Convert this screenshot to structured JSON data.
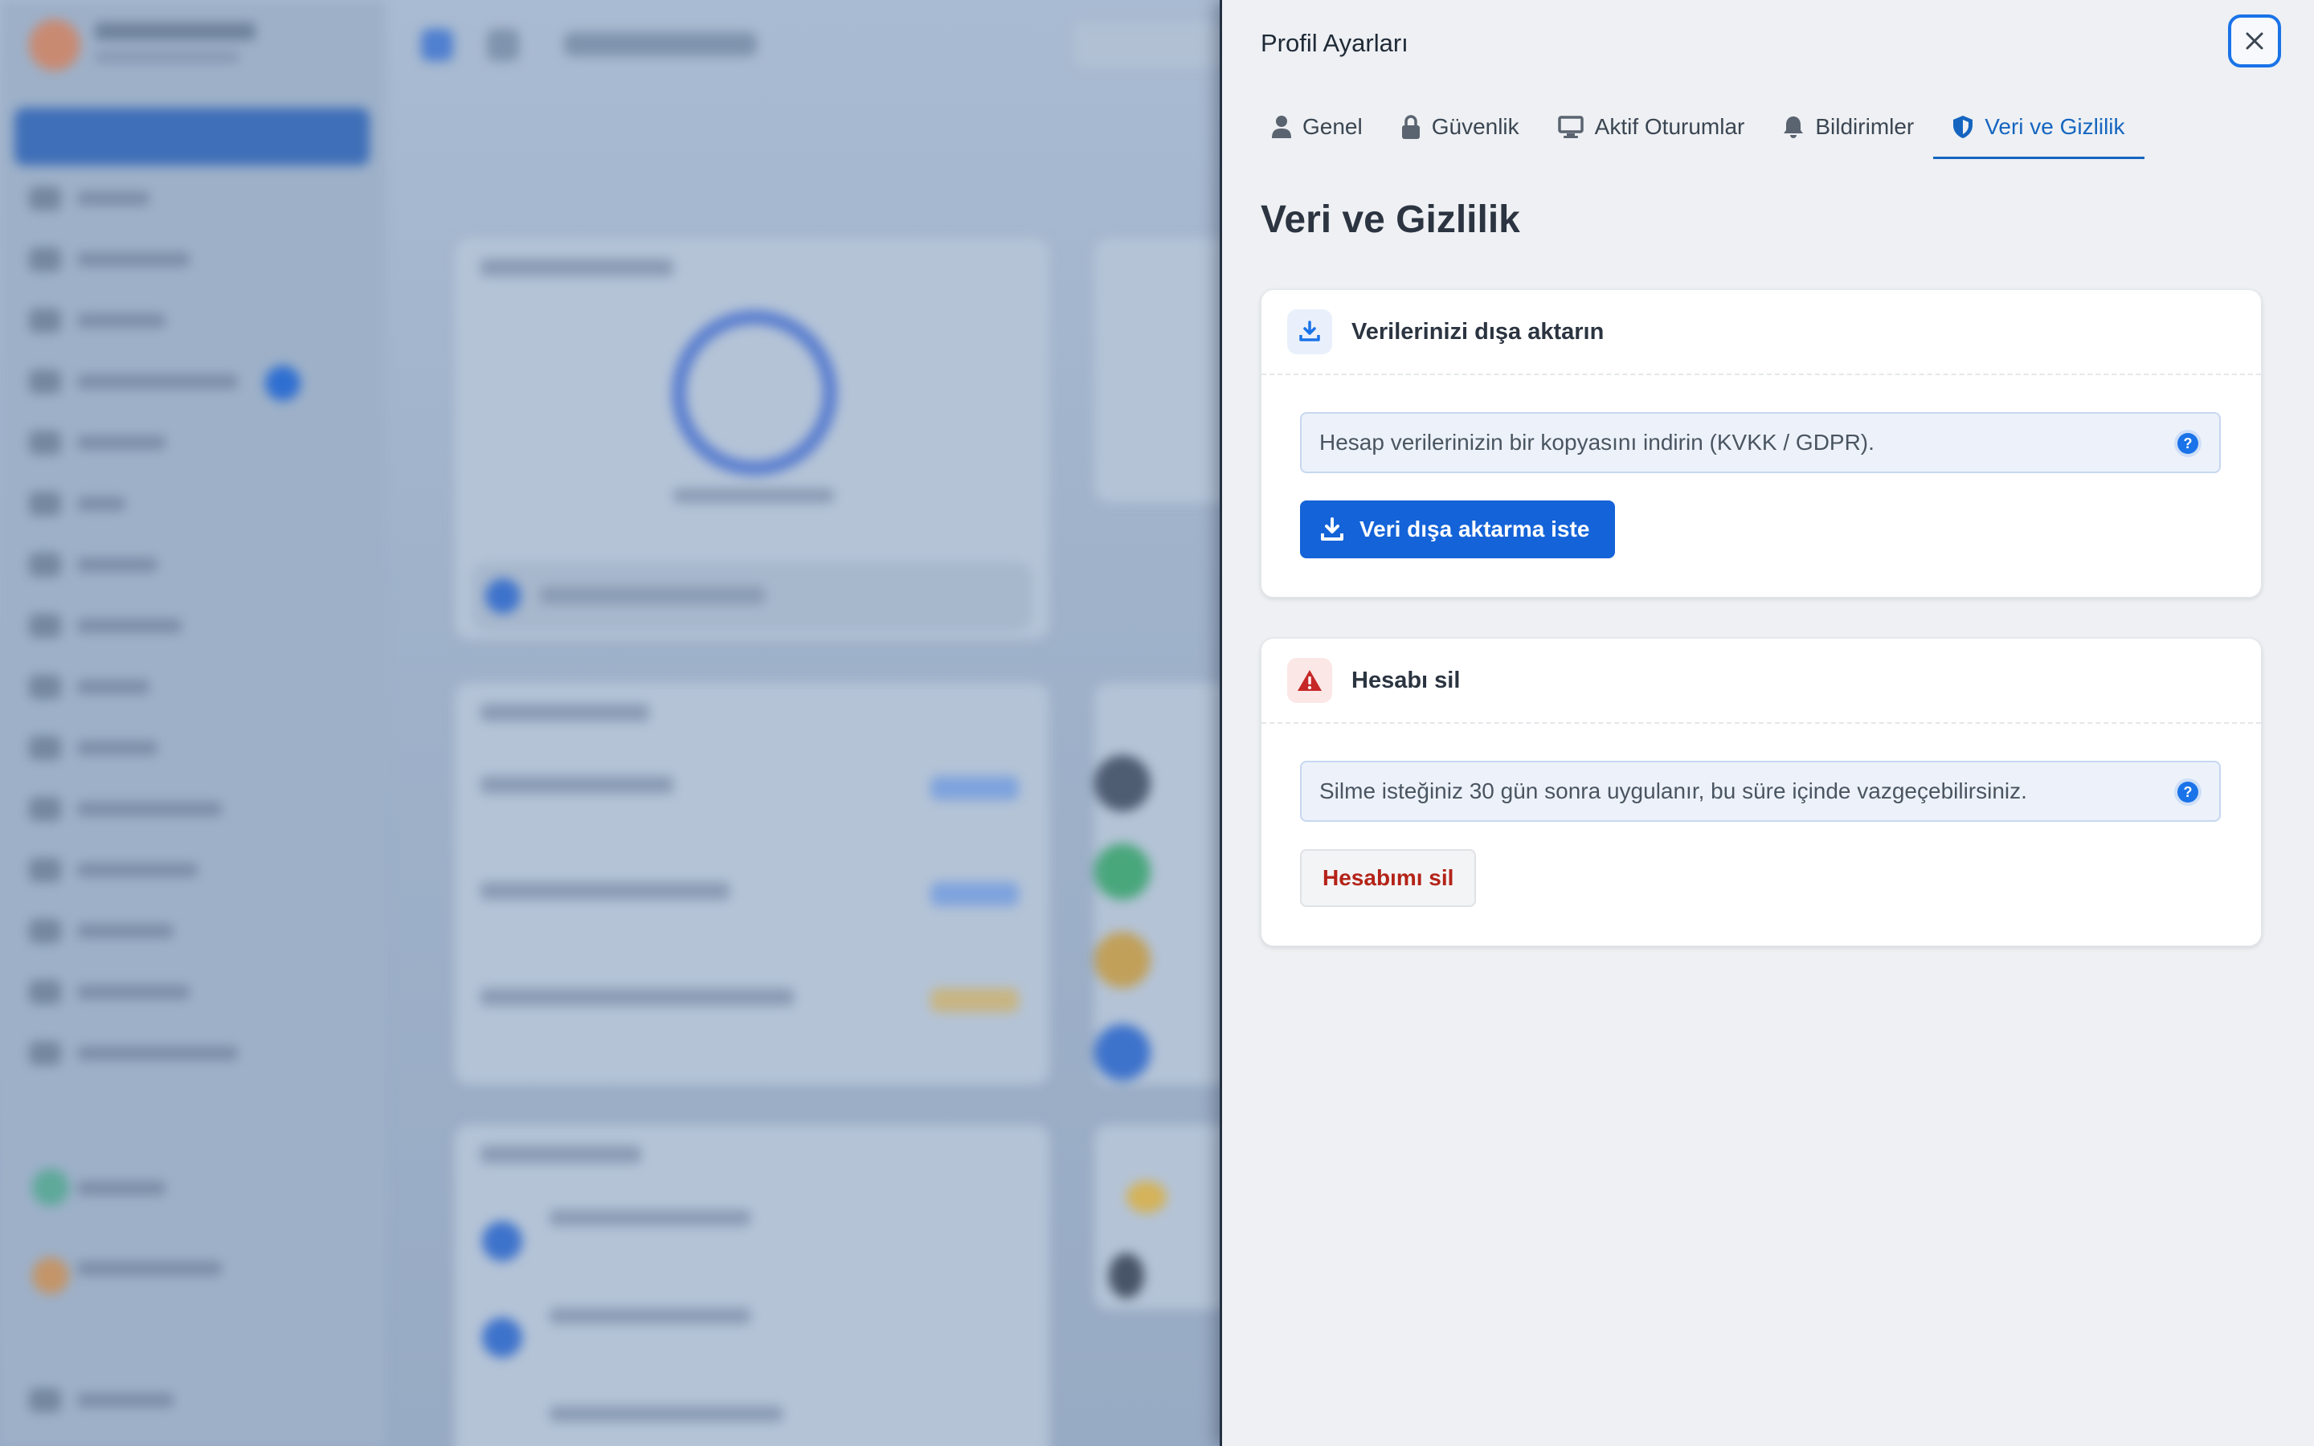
{
  "panel": {
    "title": "Profil Ayarları",
    "close_icon": "close-icon"
  },
  "tabs": [
    {
      "label": "Genel",
      "icon": "user-icon",
      "active": false
    },
    {
      "label": "Güvenlik",
      "icon": "lock-icon",
      "active": false
    },
    {
      "label": "Aktif Oturumlar",
      "icon": "monitor-icon",
      "active": false
    },
    {
      "label": "Bildirimler",
      "icon": "bell-icon",
      "active": false
    },
    {
      "label": "Veri ve Gizlilik",
      "icon": "shield-icon",
      "active": true
    }
  ],
  "section_title": "Veri ve Gizlilik",
  "export_card": {
    "title": "Verilerinizi dışa aktarın",
    "icon": "download-icon",
    "info": "Hesap verilerinizin bir kopyasını indirin (KVKK / GDPR).",
    "help_icon": "?",
    "button_label": "Veri dışa aktarma iste"
  },
  "delete_card": {
    "title": "Hesabı sil",
    "icon": "warning-icon",
    "info": "Silme isteğiniz 30 gün sonra uygulanır, bu süre içinde vazgeçebilirsiniz.",
    "help_icon": "?",
    "button_label": "Hesabımı sil"
  },
  "colors": {
    "accent": "#1463d8",
    "danger": "#b42318",
    "panel_bg": "#eef0f3"
  }
}
